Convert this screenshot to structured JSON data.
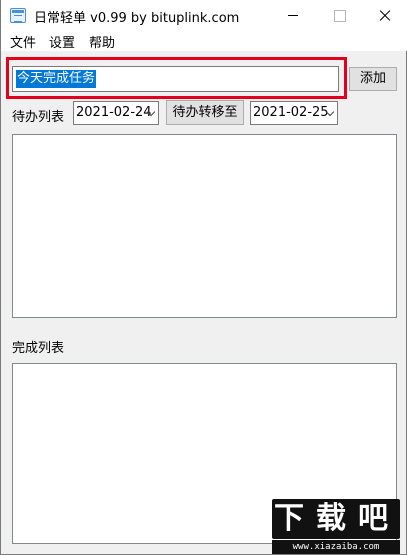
{
  "window": {
    "title": "日常轻单 v0.99 by bituplink.com"
  },
  "menu": {
    "file": "文件",
    "settings": "设置",
    "help": "帮助"
  },
  "task_input": {
    "value": "今天完成任务"
  },
  "buttons": {
    "add": "添加",
    "move_todo_to": "待办转移至"
  },
  "todo": {
    "label": "待办列表",
    "from_date": "2021-02-24",
    "to_date": "2021-02-25",
    "items": []
  },
  "done": {
    "label": "完成列表",
    "items": []
  },
  "watermark": {
    "chars": [
      "下",
      "载",
      "吧"
    ],
    "url": "www.xiazaiba.com"
  },
  "colors": {
    "highlight": "#e3001b",
    "selection": "#0078d7"
  },
  "icons": {
    "app": "app-list-icon",
    "minimize": "minimize-icon",
    "maximize": "maximize-icon",
    "close": "close-icon",
    "dropdown": "chevron-down-icon"
  }
}
